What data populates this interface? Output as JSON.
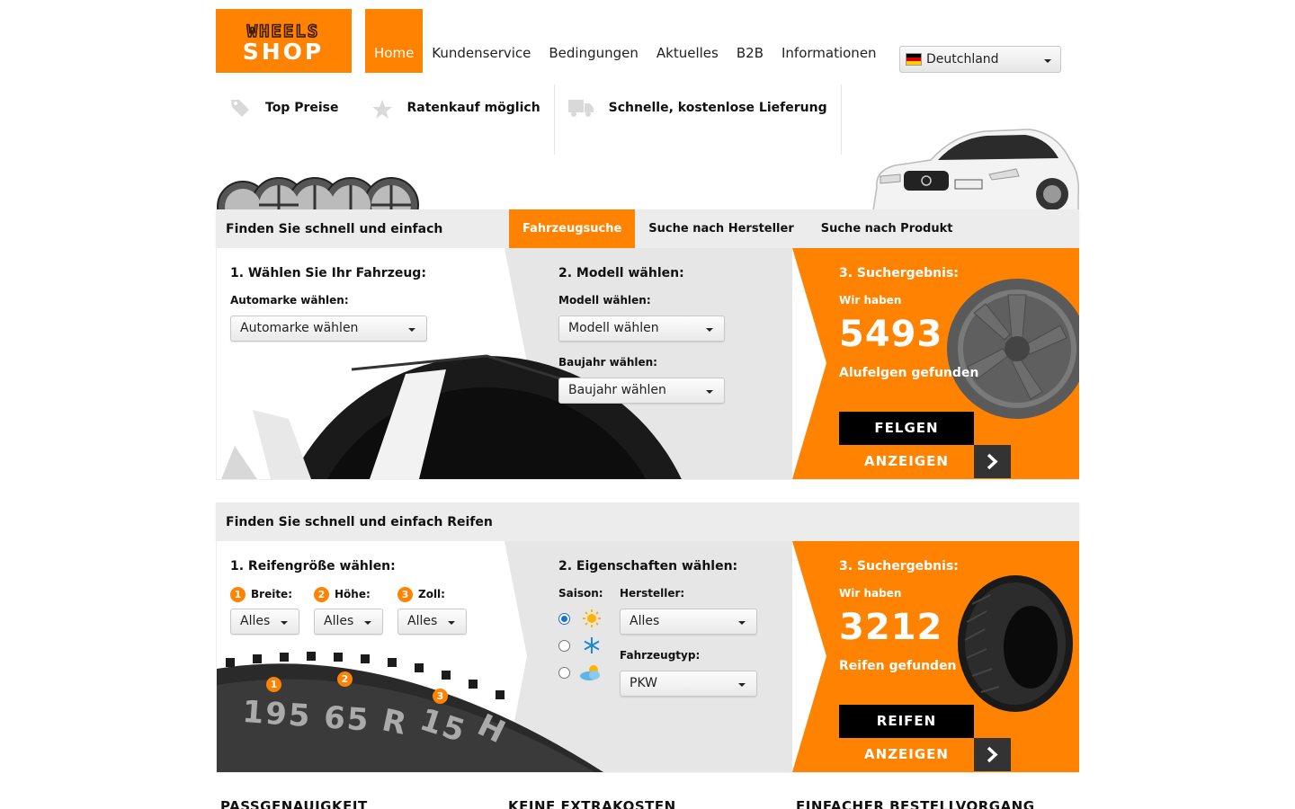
{
  "brand": {
    "logo_line1": "WHEELS",
    "logo_line2": "SHOP",
    "accent": "#ff8200"
  },
  "nav": {
    "items": [
      {
        "label": "Home",
        "active": true
      },
      {
        "label": "Kundenservice"
      },
      {
        "label": "Bedingungen"
      },
      {
        "label": "Aktuelles"
      },
      {
        "label": "B2B"
      },
      {
        "label": "Informationen"
      }
    ],
    "country": {
      "label": "Deutchland",
      "flag_icon": "germany-flag-icon"
    }
  },
  "usp": [
    {
      "icon": "tag-icon",
      "label": "Top Preise"
    },
    {
      "icon": "star-icon",
      "label": "Ratenkauf möglich"
    },
    {
      "icon": "truck-icon",
      "label": "Schnelle, kostenlose Lieferung"
    }
  ],
  "rims_search": {
    "heading": "Finden Sie schnell und einfach",
    "tabs": [
      {
        "label": "Fahrzeugsuche",
        "active": true
      },
      {
        "label": "Suche nach Hersteller"
      },
      {
        "label": "Suche nach Produkt"
      }
    ],
    "step1": {
      "title": "1. Wählen Sie Ihr Fahrzeug:",
      "make_label": "Automarke wählen:",
      "make_value": "Automarke wählen"
    },
    "step2": {
      "title": "2. Modell wählen:",
      "model_label": "Modell wählen:",
      "model_value": "Modell wählen",
      "year_label": "Baujahr wählen:",
      "year_value": "Baujahr wählen"
    },
    "step3": {
      "title": "3. Suchergebnis:",
      "sub": "Wir haben",
      "count": "5493",
      "found": "Alufelgen gefunden",
      "cta_top": "FELGEN",
      "cta_bottom": "ANZEIGEN"
    }
  },
  "tyre_search": {
    "heading": "Finden Sie schnell und einfach Reifen",
    "step1": {
      "title": "1. Reifengröße wählen:",
      "width_num": "1",
      "width_label": "Breite:",
      "width_value": "Alles",
      "height_num": "2",
      "height_label": "Höhe:",
      "height_value": "Alles",
      "rim_num": "3",
      "rim_label": "Zoll:",
      "rim_value": "Alles",
      "sidewall": {
        "a": "195",
        "b": "65",
        "c": "R",
        "d": "15",
        "e": "H",
        "n1": "1",
        "n2": "2",
        "n3": "3"
      }
    },
    "step2": {
      "title": "2. Eigenschaften wählen:",
      "season_label": "Saison:",
      "seasons": [
        {
          "icon": "sun-icon",
          "checked": true
        },
        {
          "icon": "snowflake-icon",
          "checked": false
        },
        {
          "icon": "cloud-sun-icon",
          "checked": false
        }
      ],
      "maker_label": "Hersteller:",
      "maker_value": "Alles",
      "type_label": "Fahrzeugtyp:",
      "type_value": "PKW"
    },
    "step3": {
      "title": "3. Suchergebnis:",
      "sub": "Wir haben",
      "count": "3212",
      "found": "Reifen gefunden",
      "cta_top": "REIFEN",
      "cta_bottom": "ANZEIGEN"
    }
  },
  "footer": {
    "headings": [
      "PASSGENAUIGKEIT",
      "KEINE EXTRAKOSTEN",
      "EINFACHER BESTELLVORGANG"
    ]
  }
}
